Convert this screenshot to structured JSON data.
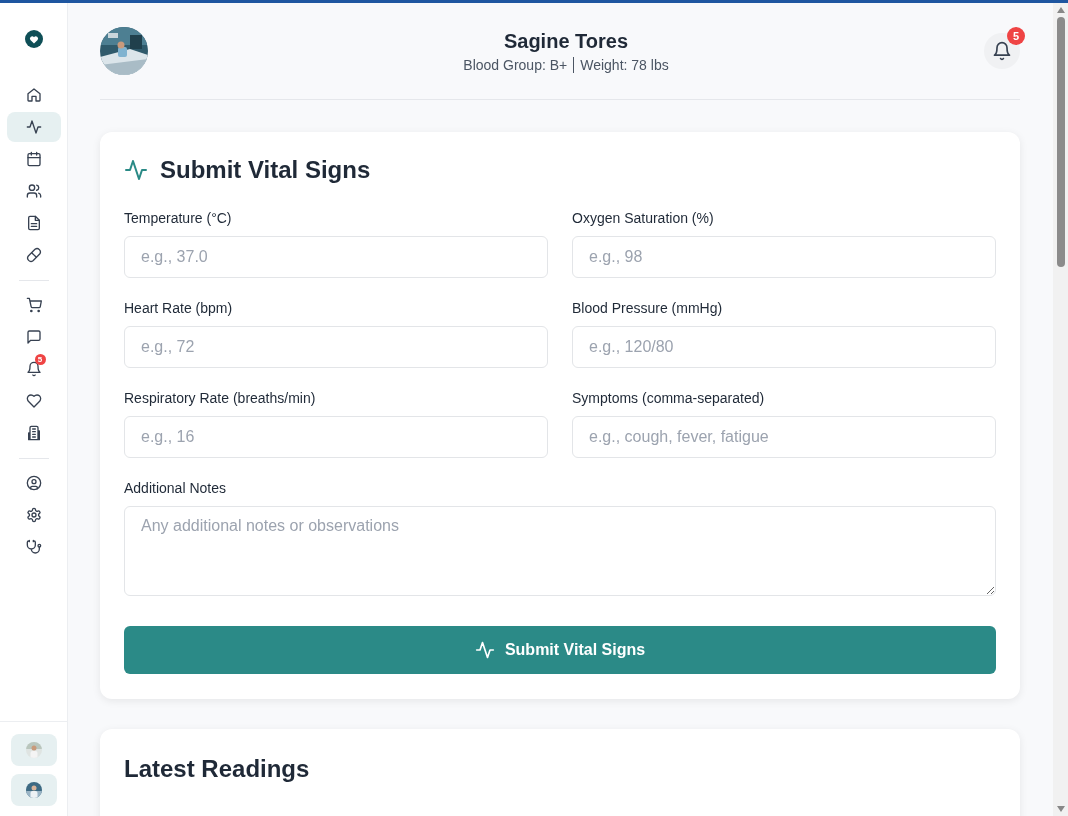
{
  "sidebar": {
    "groups": [
      {
        "items": [
          {
            "selected": false
          },
          {
            "selected": true
          },
          {
            "selected": false
          },
          {
            "selected": false
          },
          {
            "selected": false
          },
          {
            "selected": false
          }
        ]
      },
      {
        "items": [
          {
            "selected": false
          },
          {
            "selected": false
          },
          {
            "selected": false,
            "badge": "5"
          },
          {
            "selected": false
          },
          {
            "selected": false
          }
        ]
      },
      {
        "items": [
          {
            "selected": false
          },
          {
            "selected": false
          },
          {
            "selected": false
          }
        ]
      }
    ]
  },
  "header": {
    "name": "Sagine Tores",
    "blood_group": "Blood Group: B+",
    "weight": "Weight: 78 lbs",
    "notification_count": "5"
  },
  "form": {
    "title": "Submit Vital Signs",
    "fields": [
      {
        "kind": "input",
        "label": "Temperature (°C)",
        "placeholder": "e.g., 37.0"
      },
      {
        "kind": "input",
        "label": "Oxygen Saturation (%)",
        "placeholder": "e.g., 98"
      },
      {
        "kind": "input",
        "label": "Heart Rate (bpm)",
        "placeholder": "e.g., 72"
      },
      {
        "kind": "input",
        "label": "Blood Pressure (mmHg)",
        "placeholder": "e.g., 120/80"
      },
      {
        "kind": "input",
        "label": "Respiratory Rate (breaths/min)",
        "placeholder": "e.g., 16"
      },
      {
        "kind": "input",
        "label": "Symptoms (comma-separated)",
        "placeholder": "e.g., cough, fever, fatigue"
      },
      {
        "kind": "textarea",
        "label": "Additional Notes",
        "placeholder": "Any additional notes or observations"
      }
    ],
    "submit": "Submit Vital Signs"
  },
  "latest": {
    "title": "Latest Readings"
  }
}
